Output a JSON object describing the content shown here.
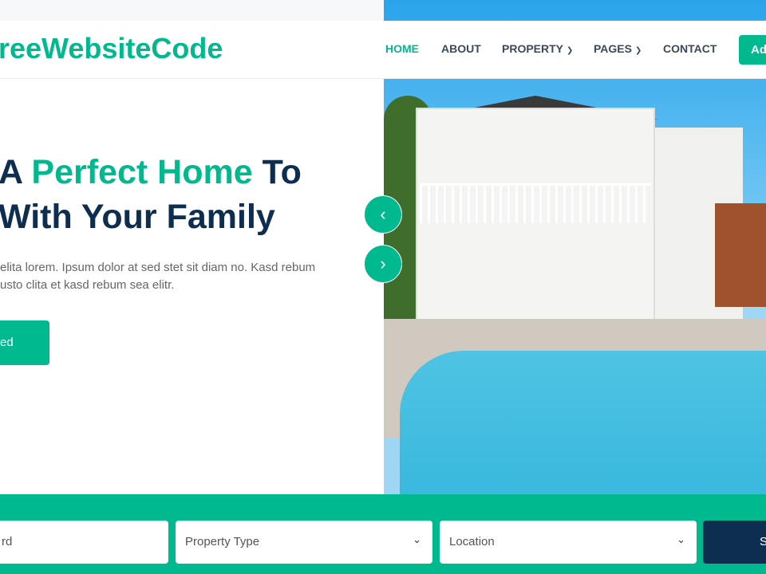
{
  "brand": {
    "logo": "reeWebsiteCode",
    "accent": "#00b98e",
    "dark": "#0e2e50"
  },
  "nav": {
    "items": [
      {
        "label": "HOME",
        "active": true
      },
      {
        "label": "ABOUT"
      },
      {
        "label": "PROPERTY",
        "dropdown": true
      },
      {
        "label": "PAGES",
        "dropdown": true
      },
      {
        "label": "CONTACT"
      }
    ],
    "add_button": "Ad"
  },
  "hero": {
    "line1_pre": "A ",
    "line1_accent": "Perfect Home",
    "line1_post": " To",
    "line2": "With Your Family",
    "para_line1": "elita lorem. Ipsum dolor at sed stet sit diam no. Kasd rebum",
    "para_line2": "usto clita et kasd rebum sea elitr.",
    "cta": "ed",
    "prev_icon": "chevron-left-icon",
    "next_icon": "chevron-right-icon"
  },
  "search": {
    "keyword_placeholder": "rd",
    "property_type": "Property Type",
    "location": "Location",
    "button": "S"
  }
}
